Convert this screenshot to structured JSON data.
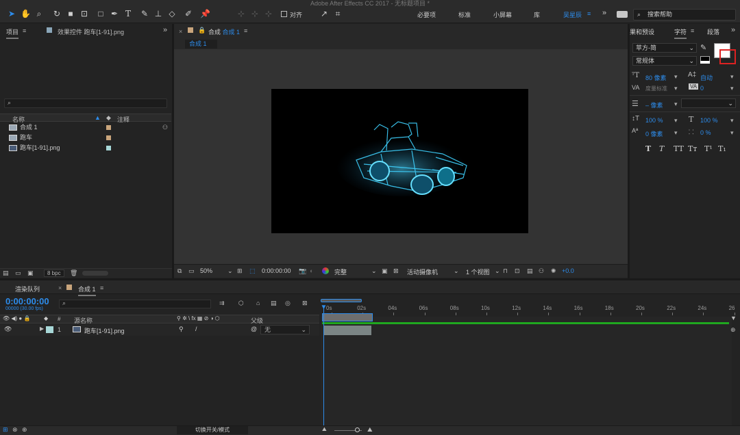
{
  "app": {
    "title": "Adobe After Effects CC 2017 - 无标题项目 *"
  },
  "toolbar": {
    "align_label": "对齐",
    "workspaces": [
      "必要项",
      "标准",
      "小屏幕",
      "库"
    ],
    "active_workspace": "吴星辰",
    "help_placeholder": "搜索帮助"
  },
  "project": {
    "tab_label": "项目",
    "effects_tab": "效果控件 跑车[1-91].png",
    "col_name": "名称",
    "col_comment": "注释",
    "items": [
      {
        "name": "合成 1",
        "color": "#c9a57c"
      },
      {
        "name": "跑车",
        "color": "#c9a57c"
      },
      {
        "name": "跑车[1-91].png",
        "color": "#a8d8d8"
      }
    ],
    "bpc": "8 bpc"
  },
  "composition": {
    "tab_label": "合成",
    "tab_name": "合成 1",
    "subtab": "合成 1",
    "zoom": "50%",
    "timecode": "0:00:00:00",
    "quality": "完整",
    "camera": "活动摄像机",
    "views": "1 个视图",
    "exposure": "+0.0"
  },
  "character": {
    "tab_effects": "果和预设",
    "tab_char": "字符",
    "tab_para": "段落",
    "font": "苹方-简",
    "style": "常规体",
    "size": "80 像素",
    "leading": "自动",
    "kerning": "度量标准",
    "tracking": "0",
    "stroke_width": "– 像素",
    "vscale": "100 %",
    "hscale": "100 %",
    "baseline": "0 像素",
    "tsume": "0 %",
    "styles": [
      "T",
      "T",
      "TT",
      "Tт",
      "T¹",
      "T₁"
    ]
  },
  "timeline": {
    "render_tab": "渲染队列",
    "comp_tab": "合成 1",
    "timecode": "0:00:00:00",
    "frame_info": "00000 (30.00 fps)",
    "col_source": "源名称",
    "col_parent": "父级",
    "layer": {
      "num": "1",
      "name": "跑车[1-91].png",
      "parent": "无"
    },
    "ticks": [
      "0s",
      "02s",
      "04s",
      "06s",
      "08s",
      "10s",
      "12s",
      "14s",
      "16s",
      "18s",
      "20s",
      "22s",
      "24s",
      "26"
    ],
    "toggle_label": "切换开关/模式"
  }
}
